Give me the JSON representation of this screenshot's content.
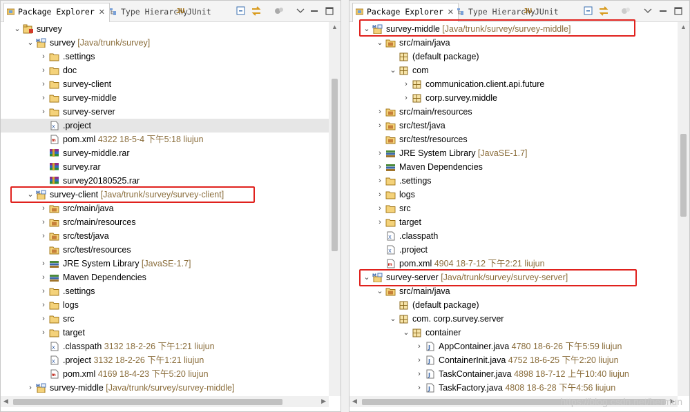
{
  "left": {
    "tabs": [
      {
        "label": "Package Explorer",
        "active": true,
        "close": "✕"
      },
      {
        "label": "Type Hierarchy",
        "active": false
      },
      {
        "label": "JUnit",
        "prefix": "JU",
        "active": false
      }
    ],
    "rows": [
      {
        "indent": 0,
        "tw": "down",
        "icon": "project-icon",
        "text": "survey",
        "dim": ""
      },
      {
        "indent": 1,
        "tw": "down",
        "icon": "maven-project-icon",
        "text": "survey",
        "dim": " [Java/trunk/survey]"
      },
      {
        "indent": 2,
        "tw": "right",
        "icon": "folder-icon",
        "text": ".settings",
        "dim": ""
      },
      {
        "indent": 2,
        "tw": "right",
        "icon": "folder-icon",
        "text": "doc",
        "dim": ""
      },
      {
        "indent": 2,
        "tw": "right",
        "icon": "folder-icon",
        "text": "survey-client",
        "dim": ""
      },
      {
        "indent": 2,
        "tw": "right",
        "icon": "folder-icon",
        "text": "survey-middle",
        "dim": ""
      },
      {
        "indent": 2,
        "tw": "right",
        "icon": "folder-icon",
        "text": "survey-server",
        "dim": ""
      },
      {
        "indent": 2,
        "tw": "none",
        "icon": "xml-file-icon",
        "text": ".project",
        "dim": "",
        "hl": true
      },
      {
        "indent": 2,
        "tw": "none",
        "icon": "pom-file-icon",
        "text": "pom.xml",
        "dim": "  4322  18-5-4 下午5:18  liujun"
      },
      {
        "indent": 2,
        "tw": "none",
        "icon": "rar-file-icon",
        "text": "survey-middle.rar",
        "dim": ""
      },
      {
        "indent": 2,
        "tw": "none",
        "icon": "rar-file-icon",
        "text": "survey.rar",
        "dim": ""
      },
      {
        "indent": 2,
        "tw": "none",
        "icon": "rar-file-icon",
        "text": "survey20180525.rar",
        "dim": ""
      },
      {
        "indent": 1,
        "tw": "down",
        "icon": "maven-project-icon",
        "text": "survey-client",
        "dim": " [Java/trunk/survey/survey-client]"
      },
      {
        "indent": 2,
        "tw": "right",
        "icon": "source-folder-icon",
        "text": "src/main/java",
        "dim": ""
      },
      {
        "indent": 2,
        "tw": "right",
        "icon": "source-folder-icon",
        "text": "src/main/resources",
        "dim": ""
      },
      {
        "indent": 2,
        "tw": "right",
        "icon": "source-folder-icon",
        "text": "src/test/java",
        "dim": ""
      },
      {
        "indent": 2,
        "tw": "none",
        "icon": "source-folder-icon",
        "text": "src/test/resources",
        "dim": ""
      },
      {
        "indent": 2,
        "tw": "right",
        "icon": "library-icon",
        "text": "JRE System Library",
        "dim": " [JavaSE-1.7]"
      },
      {
        "indent": 2,
        "tw": "right",
        "icon": "library-icon",
        "text": "Maven Dependencies",
        "dim": ""
      },
      {
        "indent": 2,
        "tw": "right",
        "icon": "folder-icon",
        "text": ".settings",
        "dim": ""
      },
      {
        "indent": 2,
        "tw": "right",
        "icon": "folder-icon",
        "text": "logs",
        "dim": ""
      },
      {
        "indent": 2,
        "tw": "right",
        "icon": "folder-icon",
        "text": "src",
        "dim": ""
      },
      {
        "indent": 2,
        "tw": "right",
        "icon": "folder-icon",
        "text": "target",
        "dim": ""
      },
      {
        "indent": 2,
        "tw": "none",
        "icon": "xml-file-icon",
        "text": ".classpath",
        "dim": "  3132  18-2-26 下午1:21  liujun"
      },
      {
        "indent": 2,
        "tw": "none",
        "icon": "xml-file-icon",
        "text": ".project",
        "dim": "  3132  18-2-26 下午1:21  liujun"
      },
      {
        "indent": 2,
        "tw": "none",
        "icon": "pom-file-icon",
        "text": "pom.xml",
        "dim": "  4169  18-4-23 下午5:20  liujun"
      },
      {
        "indent": 1,
        "tw": "right",
        "icon": "maven-project-icon",
        "text": "survey-middle",
        "dim": " [Java/trunk/survey/survey-middle]"
      }
    ]
  },
  "right": {
    "tabs": [
      {
        "label": "Package Explorer",
        "active": true,
        "close": "✕"
      },
      {
        "label": "Type Hierarchy",
        "active": false
      },
      {
        "label": "JUnit",
        "prefix": "JU",
        "active": false
      }
    ],
    "rows": [
      {
        "indent": 1,
        "tw": "down",
        "icon": "maven-project-icon",
        "text": "survey-middle",
        "dim": " [Java/trunk/survey/survey-middle]"
      },
      {
        "indent": 2,
        "tw": "down",
        "icon": "source-folder-icon",
        "text": "src/main/java",
        "dim": ""
      },
      {
        "indent": 3,
        "tw": "none",
        "icon": "package-icon",
        "text": "(default package)",
        "dim": ""
      },
      {
        "indent": 3,
        "tw": "down",
        "icon": "package-icon",
        "text": "com",
        "dim": ""
      },
      {
        "indent": 4,
        "tw": "right",
        "icon": "package-icon",
        "text": "communication.client.api.future",
        "dim": ""
      },
      {
        "indent": 4,
        "tw": "right",
        "icon": "package-icon",
        "text": "corp.survey.middle",
        "dim": ""
      },
      {
        "indent": 2,
        "tw": "right",
        "icon": "source-folder-icon",
        "text": "src/main/resources",
        "dim": ""
      },
      {
        "indent": 2,
        "tw": "right",
        "icon": "source-folder-icon",
        "text": "src/test/java",
        "dim": ""
      },
      {
        "indent": 2,
        "tw": "none",
        "icon": "source-folder-icon",
        "text": "src/test/resources",
        "dim": ""
      },
      {
        "indent": 2,
        "tw": "right",
        "icon": "library-icon",
        "text": "JRE System Library",
        "dim": " [JavaSE-1.7]"
      },
      {
        "indent": 2,
        "tw": "right",
        "icon": "library-icon",
        "text": "Maven Dependencies",
        "dim": ""
      },
      {
        "indent": 2,
        "tw": "right",
        "icon": "folder-icon",
        "text": ".settings",
        "dim": ""
      },
      {
        "indent": 2,
        "tw": "right",
        "icon": "folder-icon",
        "text": "logs",
        "dim": ""
      },
      {
        "indent": 2,
        "tw": "right",
        "icon": "folder-icon",
        "text": "src",
        "dim": ""
      },
      {
        "indent": 2,
        "tw": "right",
        "icon": "folder-icon",
        "text": "target",
        "dim": ""
      },
      {
        "indent": 2,
        "tw": "none",
        "icon": "xml-file-icon",
        "text": ".classpath",
        "dim": ""
      },
      {
        "indent": 2,
        "tw": "none",
        "icon": "xml-file-icon",
        "text": ".project",
        "dim": ""
      },
      {
        "indent": 2,
        "tw": "none",
        "icon": "pom-file-icon",
        "text": "pom.xml",
        "dim": "  4904  18-7-12 下午2:21  liujun"
      },
      {
        "indent": 1,
        "tw": "down",
        "icon": "maven-project-icon",
        "text": "survey-server",
        "dim": " [Java/trunk/survey/survey-server]"
      },
      {
        "indent": 2,
        "tw": "down",
        "icon": "source-folder-icon",
        "text": "src/main/java",
        "dim": ""
      },
      {
        "indent": 3,
        "tw": "none",
        "icon": "package-icon",
        "text": "(default package)",
        "dim": ""
      },
      {
        "indent": 3,
        "tw": "down",
        "icon": "package-icon",
        "text": "com.            corp.survey.server",
        "dim": ""
      },
      {
        "indent": 4,
        "tw": "down",
        "icon": "package-icon",
        "text": "container",
        "dim": ""
      },
      {
        "indent": 5,
        "tw": "right",
        "icon": "java-file-icon",
        "text": "AppContainer.java",
        "dim": "  4780  18-6-26 下午5:59  liujun"
      },
      {
        "indent": 5,
        "tw": "right",
        "icon": "java-file-icon",
        "text": "ContainerInit.java",
        "dim": "  4752  18-6-25 下午2:20  liujun"
      },
      {
        "indent": 5,
        "tw": "right",
        "icon": "java-file-icon",
        "text": "TaskContainer.java",
        "dim": "  4898  18-7-12 上午10:40  liujun"
      },
      {
        "indent": 5,
        "tw": "right",
        "icon": "java-file-icon",
        "text": "TaskFactory.java",
        "dim": "  4808  18-6-28 下午4:56  liujun"
      }
    ]
  },
  "watermark": "https://blog.csdn.net/hermun"
}
